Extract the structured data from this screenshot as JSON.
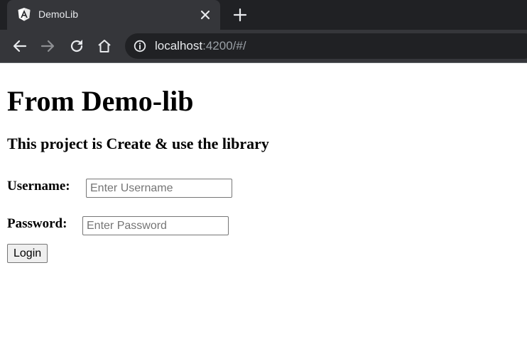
{
  "browser": {
    "tab": {
      "title": "DemoLib",
      "favicon_icon": "angular-icon",
      "close_icon": "close-icon"
    },
    "new_tab_icon": "plus-icon",
    "toolbar": {
      "back_icon": "arrow-left-icon",
      "forward_icon": "arrow-right-icon",
      "reload_icon": "reload-icon",
      "home_icon": "home-icon"
    },
    "address": {
      "info_icon": "info-icon",
      "host": "localhost",
      "rest": ":4200/#/"
    },
    "colors": {
      "tabstrip": "#202124",
      "active_tab": "#35363a",
      "omnibox": "#202124",
      "text": "#e8eaed"
    }
  },
  "page": {
    "heading": "From Demo-lib",
    "subheading": "This project is Create & use the library",
    "form": {
      "username_label": "Username:",
      "username_placeholder": "Enter Username",
      "username_value": "",
      "password_label": "Password:",
      "password_placeholder": "Enter Password",
      "password_value": "",
      "login_label": "Login"
    }
  }
}
